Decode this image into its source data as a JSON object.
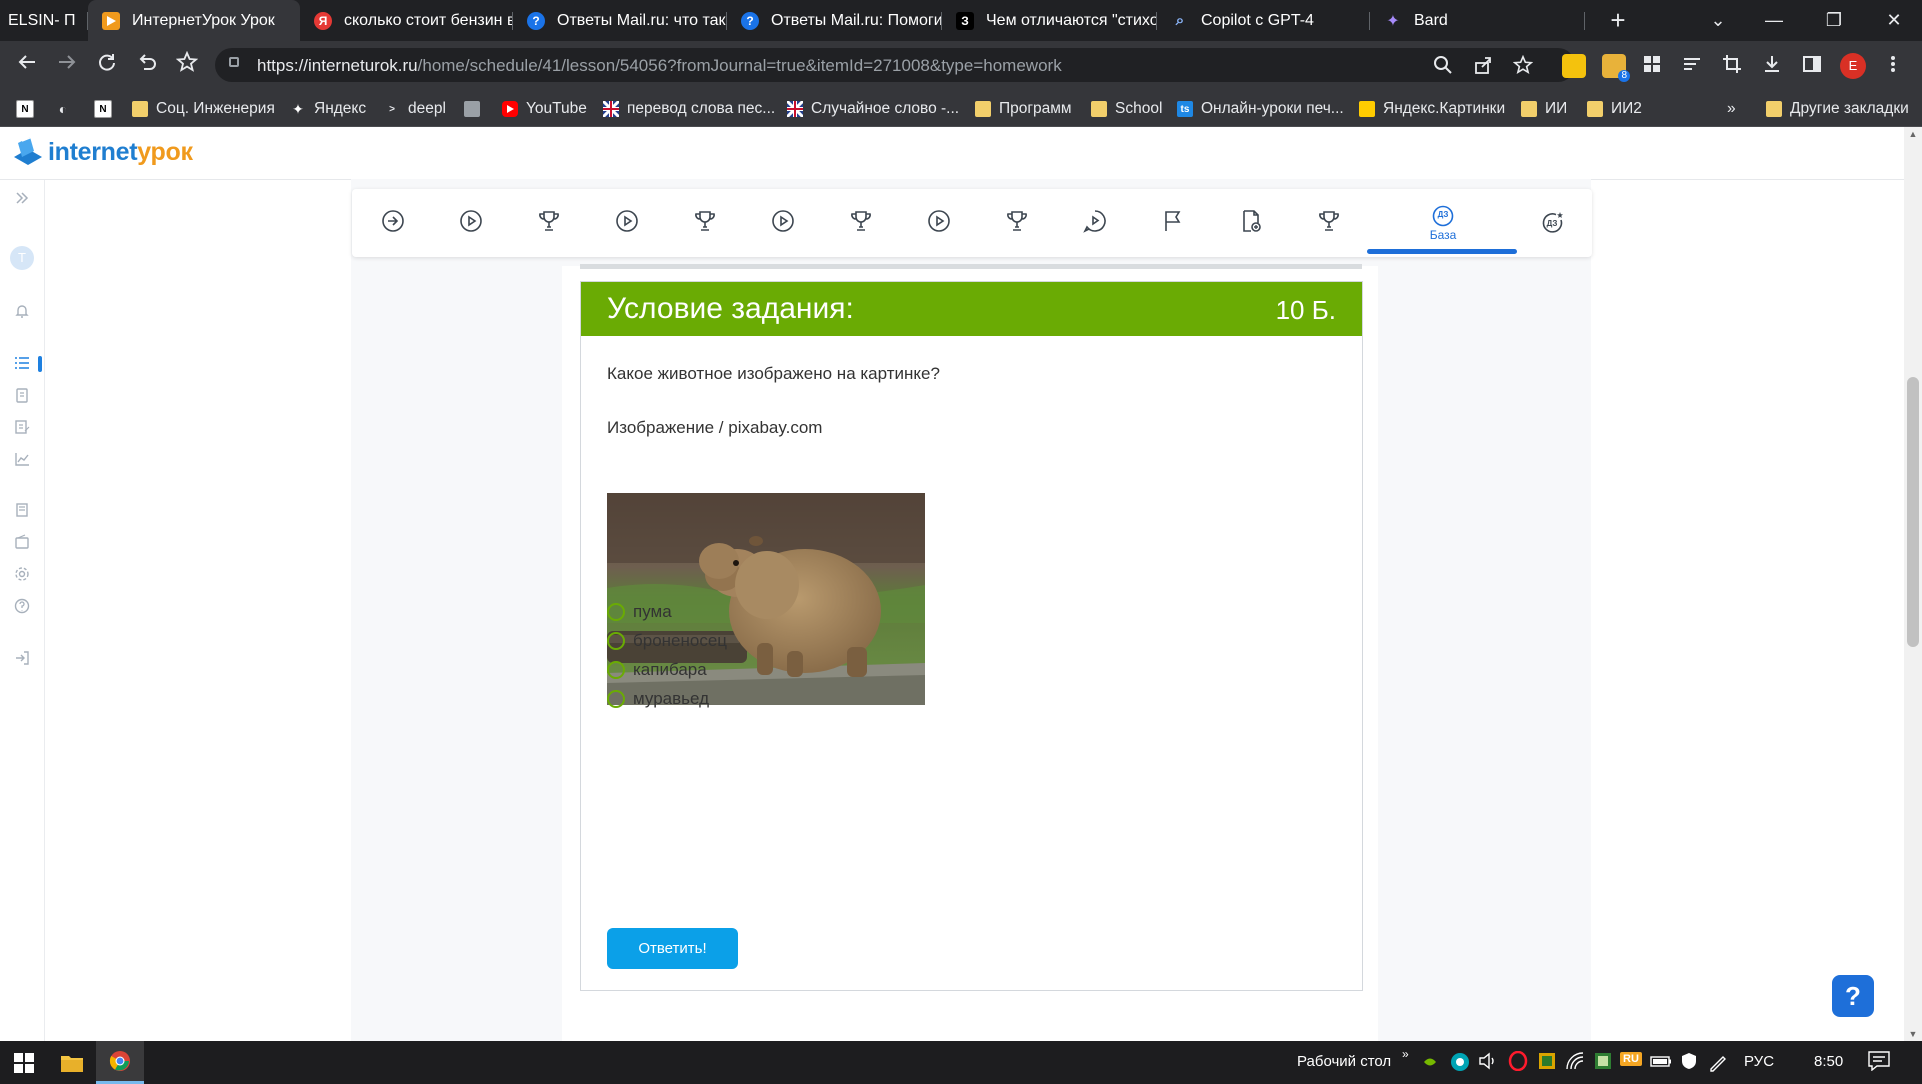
{
  "browser": {
    "tabs": [
      {
        "title": "ELSIN- П",
        "favicon_color": "#202124"
      },
      {
        "title": "ИнтернетУрок Урок",
        "favicon_color": "#f09a1d"
      },
      {
        "title": "сколько стоит бензин в",
        "favicon_color": "#e53935",
        "favicon_text": "Я"
      },
      {
        "title": "Ответы Mail.ru: что так",
        "favicon_color": "#1a73e8",
        "favicon_text": "?"
      },
      {
        "title": "Ответы Mail.ru: Помоги",
        "favicon_color": "#1a73e8",
        "favicon_text": "?"
      },
      {
        "title": "Чем отличаются \"стихо",
        "favicon_color": "#000000",
        "favicon_text": "З"
      },
      {
        "title": "Copilot с GPT-4",
        "favicon_color": "#35363a",
        "favicon_text": "Q"
      },
      {
        "title": "Bard",
        "favicon_color": "#8e6cf5",
        "favicon_text": "✦"
      }
    ],
    "new_tab": "+",
    "window_controls": {
      "dropdown": "⌄",
      "minimize": "—",
      "restore": "❐",
      "close": "✕"
    },
    "url_host": "https://interneturok.ru",
    "url_path": "/home/schedule/41/lesson/54056?fromJournal=true&itemId=271008&type=homework",
    "profile_letter": "E",
    "ext_badge": "8",
    "bookmarks": [
      {
        "label": "",
        "icon": "N"
      },
      {
        "label": "",
        "icon": "◐"
      },
      {
        "label": "",
        "icon": "N"
      },
      {
        "label": "Соц. Инженерия",
        "icon": "folder"
      },
      {
        "label": "Яндекс",
        "icon": "✦"
      },
      {
        "label": "deepl",
        "icon": ">"
      },
      {
        "label": "",
        "icon": "img"
      },
      {
        "label": "YouTube",
        "icon": "yt"
      },
      {
        "label": "перевод слова пес...",
        "icon": "uk"
      },
      {
        "label": "Случайное слово -...",
        "icon": "uk"
      },
      {
        "label": "Программ",
        "icon": "folder"
      },
      {
        "label": "School",
        "icon": "folder"
      },
      {
        "label": "Онлайн-уроки печ...",
        "icon": "ts"
      },
      {
        "label": "Яндекс.Картинки",
        "icon": "ya"
      },
      {
        "label": "ИИ",
        "icon": "folder"
      },
      {
        "label": "ИИ2",
        "icon": "folder"
      }
    ],
    "bookmarks_more": "»",
    "other_bookmarks": "Другие закладки"
  },
  "site": {
    "logo_part1": "internet",
    "logo_part2": "урок"
  },
  "lesson_steps": [
    {
      "icon": "arrow-right-circle"
    },
    {
      "icon": "play-circle"
    },
    {
      "icon": "trophy"
    },
    {
      "icon": "play-circle"
    },
    {
      "icon": "trophy"
    },
    {
      "icon": "play-circle"
    },
    {
      "icon": "trophy"
    },
    {
      "icon": "play-circle"
    },
    {
      "icon": "trophy"
    },
    {
      "icon": "chat-play"
    },
    {
      "icon": "flag"
    },
    {
      "icon": "doc-plus"
    },
    {
      "icon": "trophy"
    },
    {
      "icon": "homework",
      "badge": "ДЗ",
      "label": "База",
      "active": true
    },
    {
      "icon": "homework-star",
      "badge": "ДЗ"
    }
  ],
  "task": {
    "header": "Условие задания:",
    "points": "10 Б.",
    "question": "Какое животное изображено на картинке?",
    "image_credit": "Изображение / pixabay.com",
    "options": [
      "пума",
      "броненосец",
      "капибара",
      "муравьед"
    ],
    "submit": "Ответить!"
  },
  "help_button": "?",
  "taskbar": {
    "desktop_label": "Рабочий стол",
    "chevron": "»",
    "language": "РУС",
    "time": "8:50",
    "ru_badge": "RU"
  },
  "colors": {
    "task_header": "#6aab04",
    "submit_button": "#0ba0e8",
    "active_step": "#1e6fd9"
  }
}
